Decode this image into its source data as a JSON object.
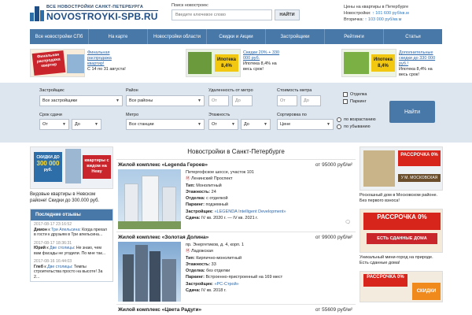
{
  "header": {
    "logo_top": "ВСЕ НОВОСТРОЙКИ САНКТ-ПЕТЕРБУРГА",
    "logo_main": "NOVOSTROYKI-SPB.RU",
    "search_label": "Поиск новостроек:",
    "search_placeholder": "Введите ключевое слово",
    "search_button": "НАЙТИ",
    "prices_title": "Цены на квартиры в Петербурге",
    "prices_new_label": "Новостройки:",
    "prices_new_value": "↑ 101 600 руб/кв.м",
    "prices_second_label": "Вторичка:",
    "prices_second_value": "↑ 103 000 руб/кв.м"
  },
  "nav": [
    "Все новостройки СПб",
    "На карте",
    "Новостройки области",
    "Скидки и Акции",
    "Застройщики",
    "Рейтинги",
    "Статьи"
  ],
  "promos": [
    {
      "img_text": "Финальная распродажа квартир",
      "img_sub": "с 14 по 31 августа",
      "link": "Финальная распродажа квартир!",
      "text": "С 14 по 31 августа!"
    },
    {
      "img_text": "Ипотека 8,4%",
      "img_sub": "",
      "link": "Скидки 20% + 330 000 руб.",
      "text": "Ипотека 8,4% на весь срок!"
    },
    {
      "img_text": "Ипотека 8,4%",
      "img_sub": "",
      "link": "Дополнительные скидки до 330 000 руб.!",
      "text": "Ипотека 8,4% на весь срок!"
    }
  ],
  "filter": {
    "developer_label": "Застройщик:",
    "developer_value": "Все застройщики",
    "district_label": "Район",
    "district_value": "Все районы",
    "metro_dist_label": "Удаленность от метро",
    "from": "От",
    "to": "До",
    "cost_label": "Стоимость метра",
    "finish_label": "Отделка",
    "parking_label": "Паркинг",
    "deadline_label": "Срок сдачи",
    "metro_label": "Метро",
    "metro_value": "Все станции",
    "floors_label": "Этажность",
    "sort_label": "Сортировка по",
    "sort_value": "Цене",
    "asc": "по возрастанию",
    "desc": "по убыванию",
    "submit": "Найти"
  },
  "left": {
    "ad_line1": "СКИДКИ ДО",
    "ad_line2": "300 000",
    "ad_line3": "руб.",
    "ad_line4": "квартиры с видом на Неву",
    "ad_caption": "Видовые квартиры в Невском районе! Скидки до 300.000 руб.",
    "reviews_title": "Последние отзывы",
    "reviews": [
      {
        "date": "2017-08-17 23:16:52",
        "name": "Димон",
        "prefix": "к",
        "target": "Три Апельсина",
        "text": "Когда прехал в гости к друзьям в Три апельсина..."
      },
      {
        "date": "2017-08-17 18:36:31",
        "name": "Юрий",
        "prefix": "к",
        "target": "Две столицы",
        "text": "Не знаю, чем вам фасады не угодили. По мне так..."
      },
      {
        "date": "2017-08-16 16:44:03",
        "name": "Глеб",
        "prefix": "к",
        "target": "Две столицы",
        "text": "Темпы строительства просто на высоте! За 2..."
      }
    ]
  },
  "center": {
    "title": "Новостройки в Санкт-Петербурге",
    "listings": [
      {
        "name": "Жилой комплекс «Legenda Героев»",
        "price": "от 95000 руб/м²",
        "address": "Петергофское шоссе, участок 101",
        "metro": "Ленинский Проспект",
        "type_label": "Тип:",
        "type": "Монолитный",
        "floors_label": "Этажность:",
        "floors": "24",
        "finish_label": "Отделка:",
        "finish": "с отделкой",
        "parking_label": "Паркинг:",
        "parking": "подземный",
        "dev_label": "Застройщик:",
        "dev": "«LEGENDA Intelligent Development»",
        "due_label": "Сдача:",
        "due": "IV кв. 2020 г. — IV кв. 2021 г."
      },
      {
        "name": "Жилой комплекс «Золотая Долина»",
        "price": "от 99000 руб/м²",
        "address": "пр. Энергетиков, д. 4, корп. 1",
        "metro": "Ладожская",
        "type_label": "Тип:",
        "type": "Кирпично-монолитный",
        "floors_label": "Этажность:",
        "floors": "33",
        "finish_label": "Отделка:",
        "finish": "без отделки",
        "parking_label": "Паркинг:",
        "parking": "Встроенно-пристроенный на 169 мест",
        "dev_label": "Застройщик:",
        "dev": "«РС-Строй»",
        "due_label": "Сдача:",
        "due": "IV кв. 2018 г."
      },
      {
        "name": "Жилой комплекс «Цвета Радуги»",
        "price": "от 55609 руб/м²"
      }
    ]
  },
  "right": {
    "ad1_title": "РАССРОЧКА 0%",
    "ad1_sub": "У М. МОСКОВСКАЯ",
    "ad1_caption": "Роскошный дом в Московском районе. Без первого взноса!",
    "ad2_title": "РАССРОЧКА 0%",
    "ad2_sub": "ЕСТЬ СДАННЫЕ ДОМА",
    "ad2_caption": "Уникальный мини-город на природе. Есть сданные дома!",
    "ad3_title": "РАССРОЧКА 0%",
    "ad3_sub": "СКИДКИ"
  },
  "colors": {
    "nav": "#4878a8",
    "filter_bg": "#dde6ef",
    "link": "#2b66a8",
    "accent_red": "#d8251c"
  }
}
